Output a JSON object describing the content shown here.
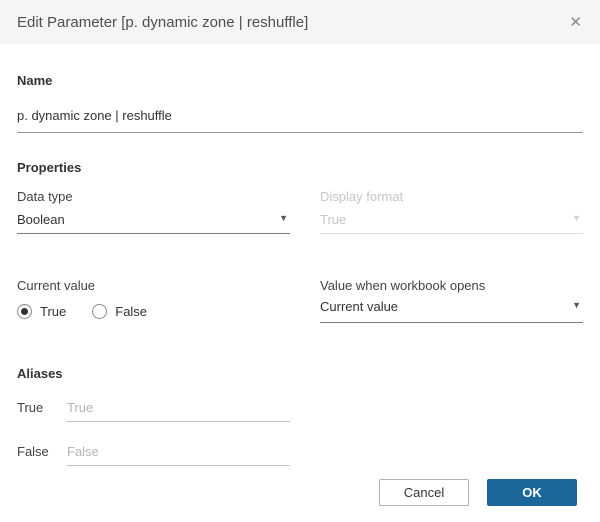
{
  "dialog": {
    "title": "Edit Parameter [p. dynamic zone | reshuffle]"
  },
  "icons": {
    "close": "✕",
    "caret_down": "▼"
  },
  "name_section": {
    "heading": "Name",
    "value": "p. dynamic zone | reshuffle"
  },
  "properties_section": {
    "heading": "Properties",
    "data_type": {
      "label": "Data type",
      "value": "Boolean"
    },
    "display_format": {
      "label": "Display format",
      "value": "True",
      "disabled": true
    },
    "current_value": {
      "label": "Current value",
      "options": [
        {
          "label": "True",
          "selected": true
        },
        {
          "label": "False",
          "selected": false
        }
      ]
    },
    "value_when_workbook_opens": {
      "label": "Value when workbook opens",
      "value": "Current value"
    }
  },
  "aliases_section": {
    "heading": "Aliases",
    "rows": [
      {
        "label": "True",
        "placeholder": "True"
      },
      {
        "label": "False",
        "placeholder": "False"
      }
    ]
  },
  "footer": {
    "cancel_label": "Cancel",
    "ok_label": "OK"
  },
  "colors": {
    "header_background": "#f5f5f5",
    "accent_blue": "#1c6799",
    "disabled_text": "#c6c6c6",
    "selected_radio_dot": "#333333"
  }
}
